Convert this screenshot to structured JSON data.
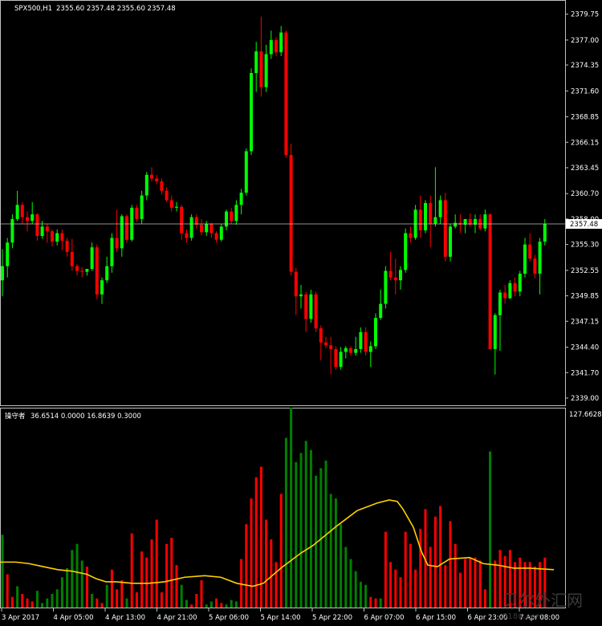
{
  "main_header": {
    "symbol_tf": "SPX500,H1",
    "ohlc": "2355.60 2357.48 2355.60 2357.48"
  },
  "sub_header": {
    "name": "操守者",
    "values": "36.6514 0.0000 16.8639 0.3000"
  },
  "current_price_label": "2357.48",
  "sub_max_label": "127.6628",
  "watermark": {
    "text": "贝尔外汇网",
    "url": "018w.com"
  },
  "colors": {
    "bull": "#00ff00",
    "bear": "#ff0000",
    "vol_up": "#008000",
    "vol_down": "#ff0000",
    "ma_line": "#ffd000",
    "price_line": "#c0c0c0",
    "text": "#ffffff"
  },
  "chart_data": [
    {
      "type": "candlestick",
      "title": "SPX500,H1",
      "ylim": [
        2338.4,
        2380.4
      ],
      "y_ticks": [
        "2379.75",
        "2377.00",
        "2374.35",
        "2371.60",
        "2368.85",
        "2366.15",
        "2363.45",
        "2360.70",
        "2358.00",
        "2355.30",
        "2352.55",
        "2349.85",
        "2347.15",
        "2344.40",
        "2341.70",
        "2339.00"
      ],
      "x_ticks": [
        "3 Apr 2017",
        "4 Apr 05:00",
        "4 Apr 13:00",
        "4 Apr 21:00",
        "5 Apr 06:00",
        "5 Apr 14:00",
        "5 Apr 22:00",
        "6 Apr 07:00",
        "6 Apr 15:00",
        "6 Apr 23:00",
        "7 Apr 08:00"
      ],
      "current_price": 2357.48,
      "candles": [
        [
          2351.5,
          2354.8,
          2349.8,
          2353.0
        ],
        [
          2353.0,
          2356.0,
          2351.8,
          2355.5
        ],
        [
          2355.5,
          2358.5,
          2354.9,
          2358.0
        ],
        [
          2358.0,
          2361.0,
          2357.8,
          2359.5
        ],
        [
          2359.5,
          2359.8,
          2357.5,
          2358.2
        ],
        [
          2358.2,
          2358.8,
          2356.7,
          2357.8
        ],
        [
          2357.8,
          2359.8,
          2357.5,
          2358.5
        ],
        [
          2358.5,
          2358.6,
          2355.7,
          2356.2
        ],
        [
          2356.2,
          2357.8,
          2355.9,
          2357.2
        ],
        [
          2357.2,
          2357.5,
          2355.5,
          2356.7
        ],
        [
          2356.7,
          2356.9,
          2355.1,
          2355.6
        ],
        [
          2355.6,
          2356.9,
          2355.2,
          2356.5
        ],
        [
          2356.5,
          2356.9,
          2354.7,
          2355.7
        ],
        [
          2355.7,
          2356.0,
          2354.0,
          2354.5
        ],
        [
          2354.5,
          2355.9,
          2352.5,
          2353.0
        ],
        [
          2353.0,
          2353.2,
          2352.0,
          2352.5
        ],
        [
          2352.5,
          2352.9,
          2351.8,
          2352.4
        ],
        [
          2352.4,
          2352.7,
          2352.0,
          2352.7
        ],
        [
          2352.7,
          2355.5,
          2352.5,
          2355.0
        ],
        [
          2355.0,
          2355.3,
          2349.5,
          2350.0
        ],
        [
          2350.0,
          2351.8,
          2349.0,
          2351.5
        ],
        [
          2351.5,
          2354.0,
          2351.2,
          2353.0
        ],
        [
          2353.0,
          2356.5,
          2352.3,
          2356.0
        ],
        [
          2356.0,
          2359.0,
          2354.5,
          2354.9
        ],
        [
          2354.9,
          2358.5,
          2354.0,
          2358.3
        ],
        [
          2358.3,
          2358.5,
          2355.5,
          2355.8
        ],
        [
          2355.8,
          2359.5,
          2355.6,
          2359.2
        ],
        [
          2359.2,
          2359.5,
          2357.7,
          2358.0
        ],
        [
          2358.0,
          2361.0,
          2357.5,
          2360.5
        ],
        [
          2360.5,
          2363.0,
          2360.0,
          2362.7
        ],
        [
          2362.7,
          2363.5,
          2362.0,
          2362.3
        ],
        [
          2362.3,
          2362.7,
          2361.7,
          2362.0
        ],
        [
          2362.0,
          2362.3,
          2360.6,
          2361.0
        ],
        [
          2361.0,
          2361.4,
          2359.8,
          2360.0
        ],
        [
          2360.0,
          2360.5,
          2358.8,
          2359.2
        ],
        [
          2359.2,
          2359.8,
          2358.8,
          2359.3
        ],
        [
          2359.3,
          2359.5,
          2355.8,
          2356.5
        ],
        [
          2356.5,
          2356.9,
          2355.5,
          2356.0
        ],
        [
          2356.0,
          2358.5,
          2355.7,
          2358.2
        ],
        [
          2358.2,
          2358.5,
          2357.0,
          2357.4
        ],
        [
          2357.4,
          2358.0,
          2356.3,
          2356.6
        ],
        [
          2356.6,
          2357.8,
          2356.2,
          2357.5
        ],
        [
          2357.5,
          2357.6,
          2356.0,
          2356.5
        ],
        [
          2356.5,
          2356.7,
          2355.5,
          2355.8
        ],
        [
          2355.8,
          2357.5,
          2355.6,
          2357.2
        ],
        [
          2357.2,
          2359.0,
          2356.8,
          2358.8
        ],
        [
          2358.8,
          2359.2,
          2357.5,
          2357.8
        ],
        [
          2357.8,
          2360.0,
          2357.4,
          2359.5
        ],
        [
          2359.5,
          2361.2,
          2358.5,
          2360.8
        ],
        [
          2360.8,
          2365.5,
          2360.5,
          2365.2
        ],
        [
          2365.2,
          2374.0,
          2364.8,
          2373.5
        ],
        [
          2373.5,
          2376.8,
          2371.5,
          2375.8
        ],
        [
          2375.8,
          2379.5,
          2371.0,
          2372.0
        ],
        [
          2372.0,
          2376.5,
          2371.5,
          2375.5
        ],
        [
          2375.5,
          2378.0,
          2375.0,
          2377.0
        ],
        [
          2377.0,
          2377.3,
          2375.3,
          2375.7
        ],
        [
          2375.7,
          2378.5,
          2375.3,
          2377.8
        ],
        [
          2377.8,
          2378.0,
          2364.5,
          2364.8
        ],
        [
          2364.8,
          2366.0,
          2352.0,
          2352.4
        ],
        [
          2352.4,
          2352.8,
          2347.8,
          2349.8
        ],
        [
          2349.8,
          2351.0,
          2348.5,
          2350.0
        ],
        [
          2350.0,
          2350.3,
          2346.0,
          2347.4
        ],
        [
          2347.4,
          2350.5,
          2347.0,
          2350.0
        ],
        [
          2350.0,
          2350.3,
          2346.0,
          2346.4
        ],
        [
          2346.4,
          2346.7,
          2343.0,
          2344.9
        ],
        [
          2344.9,
          2345.5,
          2344.3,
          2344.6
        ],
        [
          2344.6,
          2345.5,
          2341.5,
          2344.2
        ],
        [
          2344.2,
          2344.5,
          2342.0,
          2342.3
        ],
        [
          2342.3,
          2344.4,
          2342.0,
          2343.9
        ],
        [
          2343.9,
          2344.5,
          2343.2,
          2344.3
        ],
        [
          2344.3,
          2344.5,
          2343.5,
          2343.8
        ],
        [
          2343.8,
          2345.5,
          2343.5,
          2344.2
        ],
        [
          2344.2,
          2346.5,
          2343.8,
          2346.0
        ],
        [
          2346.0,
          2346.5,
          2343.5,
          2343.9
        ],
        [
          2343.9,
          2345.0,
          2342.3,
          2344.5
        ],
        [
          2344.5,
          2348.0,
          2344.2,
          2347.5
        ],
        [
          2347.5,
          2350.5,
          2347.3,
          2349.0
        ],
        [
          2349.0,
          2353.0,
          2348.5,
          2352.5
        ],
        [
          2352.5,
          2354.5,
          2351.5,
          2351.8
        ],
        [
          2351.8,
          2353.8,
          2350.0,
          2351.5
        ],
        [
          2351.5,
          2353.0,
          2350.5,
          2352.6
        ],
        [
          2352.6,
          2357.0,
          2352.3,
          2356.5
        ],
        [
          2356.5,
          2357.2,
          2355.5,
          2356.0
        ],
        [
          2356.0,
          2359.5,
          2355.8,
          2359.0
        ],
        [
          2359.0,
          2360.5,
          2356.0,
          2356.8
        ],
        [
          2356.8,
          2360.0,
          2356.5,
          2359.7
        ],
        [
          2359.7,
          2360.5,
          2355.0,
          2357.5
        ],
        [
          2357.5,
          2363.5,
          2357.2,
          2358.2
        ],
        [
          2358.2,
          2360.5,
          2357.5,
          2360.0
        ],
        [
          2360.0,
          2360.8,
          2353.5,
          2354.0
        ],
        [
          2354.0,
          2357.5,
          2353.5,
          2357.2
        ],
        [
          2357.2,
          2358.5,
          2357.0,
          2357.6
        ],
        [
          2357.6,
          2358.5,
          2356.5,
          2357.4
        ],
        [
          2357.4,
          2358.0,
          2356.5,
          2358.0
        ],
        [
          2358.0,
          2358.6,
          2357.2,
          2357.4
        ],
        [
          2357.4,
          2358.5,
          2356.5,
          2358.0
        ],
        [
          2358.0,
          2358.5,
          2356.8,
          2357.0
        ],
        [
          2357.0,
          2359.0,
          2356.7,
          2358.5
        ],
        [
          2358.5,
          2358.6,
          2345.5,
          2344.2
        ],
        [
          2344.2,
          2348.0,
          2341.5,
          2347.8
        ],
        [
          2347.8,
          2350.5,
          2344.0,
          2350.2
        ],
        [
          2350.2,
          2351.0,
          2349.0,
          2349.6
        ],
        [
          2349.6,
          2351.5,
          2349.5,
          2351.2
        ],
        [
          2351.2,
          2351.8,
          2349.8,
          2350.3
        ],
        [
          2350.3,
          2352.5,
          2349.8,
          2352.2
        ],
        [
          2352.2,
          2356.0,
          2351.8,
          2355.3
        ],
        [
          2355.3,
          2356.5,
          2353.5,
          2353.8
        ],
        [
          2353.8,
          2354.2,
          2351.7,
          2352.2
        ],
        [
          2352.2,
          2356.0,
          2350.0,
          2355.6
        ],
        [
          2355.6,
          2358.0,
          2355.2,
          2357.5
        ]
      ]
    },
    {
      "type": "bar+line",
      "title": "操守者",
      "ylim": [
        0,
        127.6628
      ],
      "volume": [
        [
          48,
          "u"
        ],
        [
          22,
          "d"
        ],
        [
          7,
          "d"
        ],
        [
          14,
          "u"
        ],
        [
          9,
          "d"
        ],
        [
          6,
          "d"
        ],
        [
          4,
          "d"
        ],
        [
          11,
          "u"
        ],
        [
          3,
          "u"
        ],
        [
          6,
          "u"
        ],
        [
          9,
          "u"
        ],
        [
          12,
          "u"
        ],
        [
          20,
          "u"
        ],
        [
          26,
          "u"
        ],
        [
          38,
          "u"
        ],
        [
          42,
          "u"
        ],
        [
          31,
          "u"
        ],
        [
          27,
          "d"
        ],
        [
          9,
          "u"
        ],
        [
          6,
          "d"
        ],
        [
          3,
          "d"
        ],
        [
          15,
          "u"
        ],
        [
          25,
          "d"
        ],
        [
          12,
          "d"
        ],
        [
          18,
          "d"
        ],
        [
          6,
          "u"
        ],
        [
          49,
          "d"
        ],
        [
          10,
          "d"
        ],
        [
          37,
          "d"
        ],
        [
          33,
          "d"
        ],
        [
          45,
          "d"
        ],
        [
          58,
          "d"
        ],
        [
          10,
          "d"
        ],
        [
          42,
          "d"
        ],
        [
          46,
          "d"
        ],
        [
          28,
          "d"
        ],
        [
          15,
          "u"
        ],
        [
          5,
          "u"
        ],
        [
          2,
          "d"
        ],
        [
          9,
          "d"
        ],
        [
          18,
          "d"
        ],
        [
          2,
          "u"
        ],
        [
          4,
          "u"
        ],
        [
          6,
          "d"
        ],
        [
          3,
          "d"
        ],
        [
          2,
          "u"
        ],
        [
          5,
          "u"
        ],
        [
          4,
          "u"
        ],
        [
          32,
          "d"
        ],
        [
          55,
          "d"
        ],
        [
          72,
          "d"
        ],
        [
          86,
          "d"
        ],
        [
          93,
          "d"
        ],
        [
          58,
          "d"
        ],
        [
          45,
          "d"
        ],
        [
          30,
          "d"
        ],
        [
          75,
          "d"
        ],
        [
          112,
          "u"
        ],
        [
          132,
          "u"
        ],
        [
          96,
          "u"
        ],
        [
          102,
          "u"
        ],
        [
          110,
          "u"
        ],
        [
          104,
          "u"
        ],
        [
          87,
          "u"
        ],
        [
          92,
          "u"
        ],
        [
          97,
          "u"
        ],
        [
          75,
          "u"
        ],
        [
          72,
          "u"
        ],
        [
          55,
          "u"
        ],
        [
          40,
          "u"
        ],
        [
          32,
          "u"
        ],
        [
          24,
          "u"
        ],
        [
          17,
          "u"
        ],
        [
          15,
          "u"
        ],
        [
          7,
          "d"
        ],
        [
          6,
          "d"
        ],
        [
          6,
          "u"
        ],
        [
          50,
          "d"
        ],
        [
          30,
          "d"
        ],
        [
          25,
          "d"
        ],
        [
          20,
          "d"
        ],
        [
          50,
          "d"
        ],
        [
          42,
          "d"
        ],
        [
          25,
          "d"
        ],
        [
          52,
          "d"
        ],
        [
          65,
          "d"
        ],
        [
          40,
          "d"
        ],
        [
          60,
          "d"
        ],
        [
          67,
          "d"
        ],
        [
          28,
          "d"
        ],
        [
          57,
          "d"
        ],
        [
          42,
          "d"
        ],
        [
          23,
          "d"
        ],
        [
          32,
          "d"
        ],
        [
          33,
          "d"
        ],
        [
          33,
          "d"
        ],
        [
          31,
          "d"
        ],
        [
          12,
          "d"
        ],
        [
          103,
          "u"
        ],
        [
          31,
          "d"
        ],
        [
          38,
          "d"
        ],
        [
          34,
          "d"
        ],
        [
          38,
          "d"
        ],
        [
          30,
          "d"
        ],
        [
          33,
          "d"
        ],
        [
          30,
          "d"
        ],
        [
          30,
          "d"
        ],
        [
          27,
          "d"
        ],
        [
          30,
          "d"
        ],
        [
          33,
          "d"
        ]
      ],
      "moving_average": [
        [
          0,
          30
        ],
        [
          20,
          30
        ],
        [
          36,
          29
        ],
        [
          54,
          27
        ],
        [
          72,
          25
        ],
        [
          90,
          24
        ],
        [
          108,
          22
        ],
        [
          120,
          19
        ],
        [
          132,
          17
        ],
        [
          145,
          17
        ],
        [
          165,
          16
        ],
        [
          185,
          16
        ],
        [
          205,
          17
        ],
        [
          230,
          20
        ],
        [
          255,
          21
        ],
        [
          275,
          20
        ],
        [
          295,
          16
        ],
        [
          315,
          14
        ],
        [
          328,
          16
        ],
        [
          350,
          26
        ],
        [
          375,
          36
        ],
        [
          390,
          41
        ],
        [
          420,
          54
        ],
        [
          445,
          64
        ],
        [
          470,
          69
        ],
        [
          485,
          71
        ],
        [
          495,
          70
        ],
        [
          502,
          65
        ],
        [
          515,
          53
        ],
        [
          525,
          37
        ],
        [
          533,
          28
        ],
        [
          545,
          27
        ],
        [
          560,
          32
        ],
        [
          585,
          33
        ],
        [
          602,
          29
        ],
        [
          620,
          28
        ],
        [
          640,
          26
        ],
        [
          660,
          26
        ],
        [
          690,
          25
        ]
      ]
    }
  ]
}
